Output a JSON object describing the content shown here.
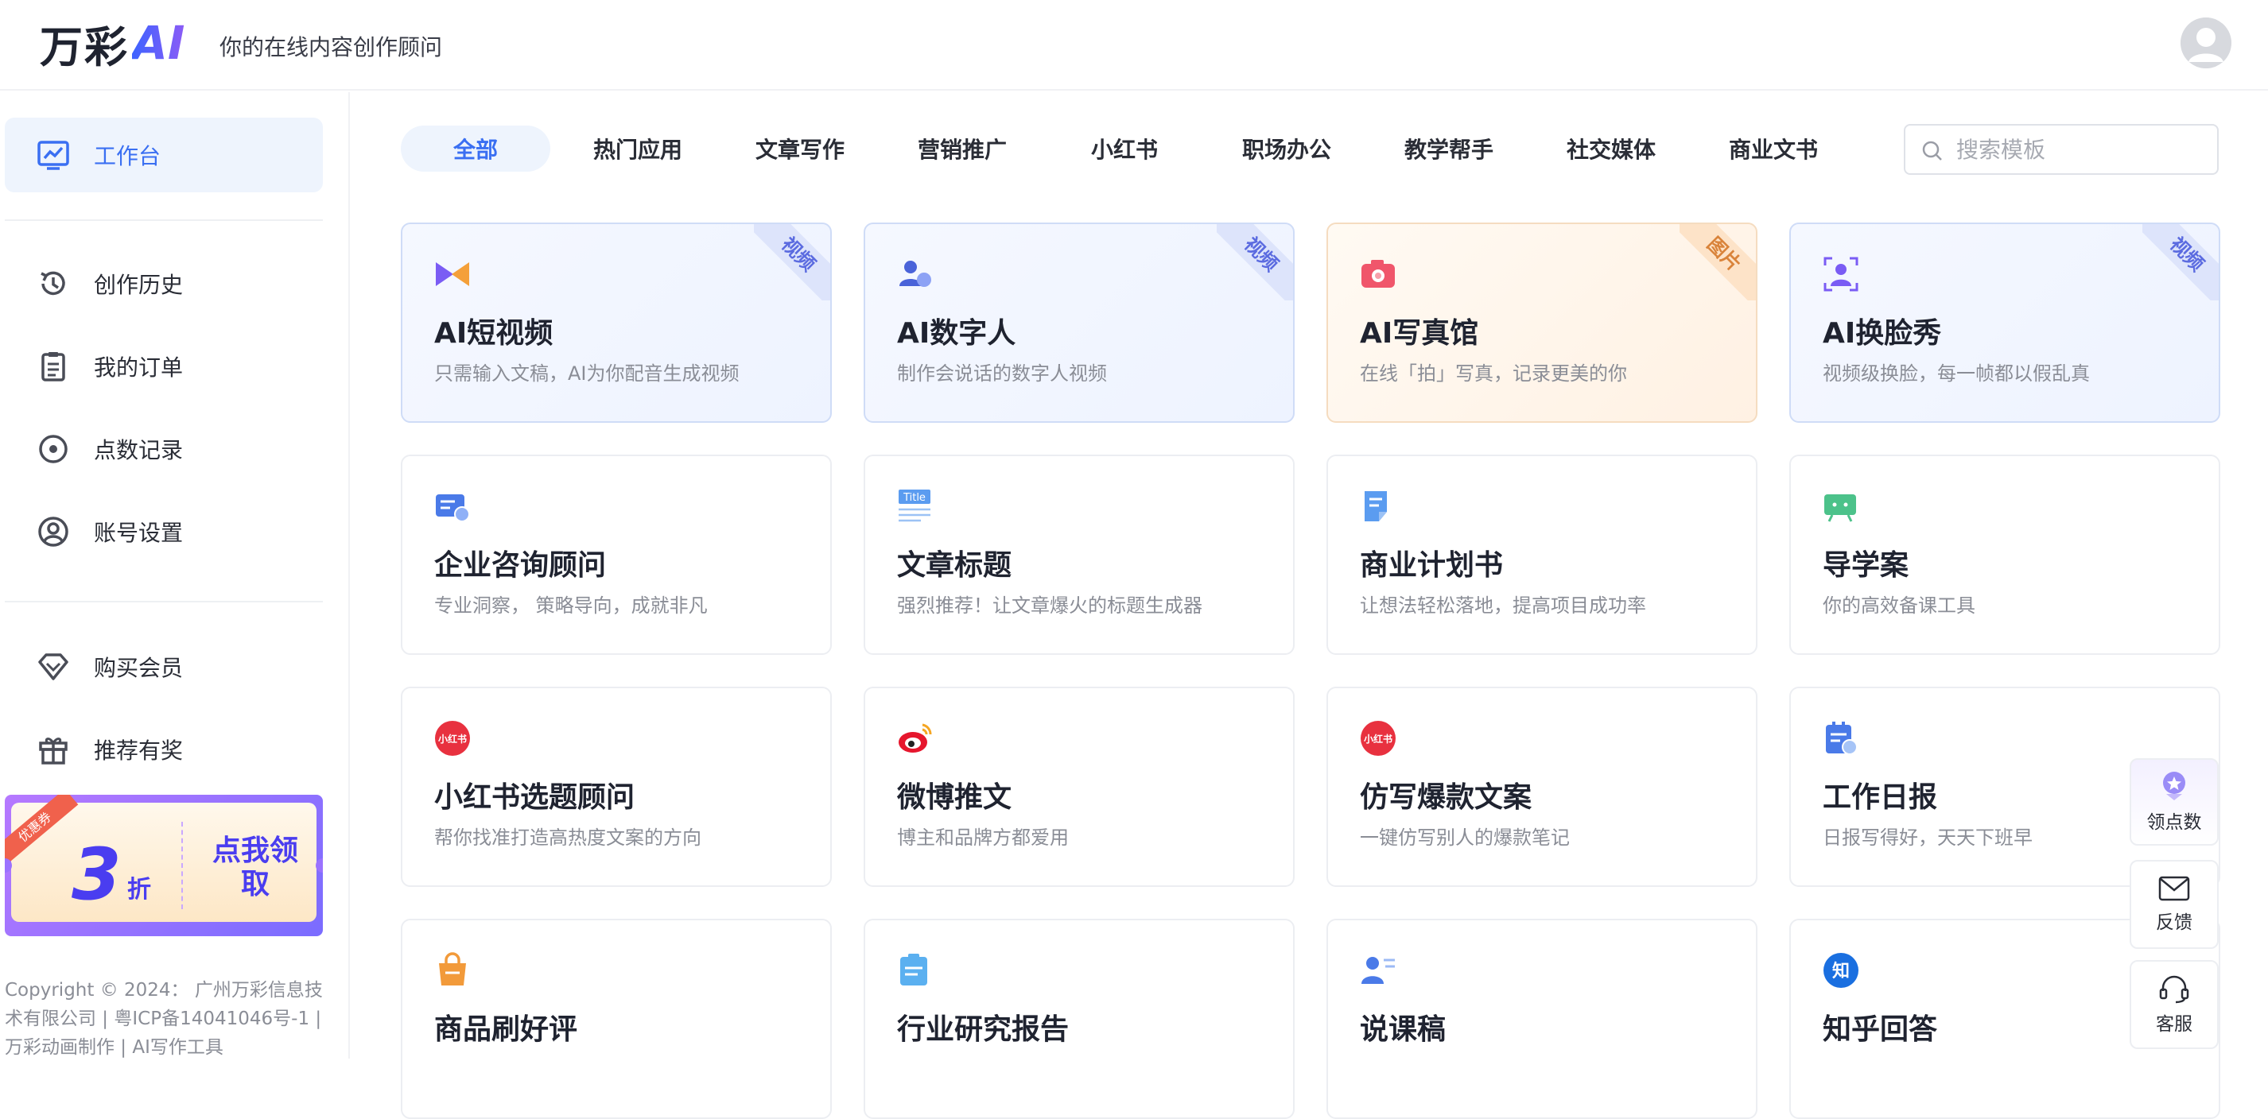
{
  "header": {
    "logo_text": "万彩",
    "logo_ai": "AI",
    "slogan": "你的在线内容创作顾问"
  },
  "sidebar": {
    "items": [
      {
        "label": "工作台",
        "icon": "dashboard-icon"
      },
      {
        "label": "创作历史",
        "icon": "history-icon"
      },
      {
        "label": "我的订单",
        "icon": "order-icon"
      },
      {
        "label": "点数记录",
        "icon": "points-icon"
      },
      {
        "label": "账号设置",
        "icon": "account-icon"
      },
      {
        "label": "购买会员",
        "icon": "diamond-icon"
      },
      {
        "label": "推荐有奖",
        "icon": "gift-icon"
      }
    ],
    "promo": {
      "ribbon": "优惠券",
      "number": "3",
      "unit": "折",
      "cta": "点我领取"
    },
    "copyright": "Copyright © 2024： 广州万彩信息技术有限公司 | 粤ICP备14041046号-1 | 万彩动画制作 | AI写作工具"
  },
  "tabs": [
    "全部",
    "热门应用",
    "文章写作",
    "营销推广",
    "小红书",
    "职场办公",
    "教学帮手",
    "社交媒体",
    "商业文书"
  ],
  "search": {
    "placeholder": "搜索模板"
  },
  "cards": [
    {
      "title": "AI短视频",
      "desc": "只需输入文稿，AI为你配音生成视频",
      "badge": "视频",
      "icon": "video-play-icon"
    },
    {
      "title": "AI数字人",
      "desc": "制作会说话的数字人视频",
      "badge": "视频",
      "icon": "digital-human-icon"
    },
    {
      "title": "AI写真馆",
      "desc": "在线「拍」写真，记录更美的你",
      "badge": "图片",
      "icon": "camera-icon"
    },
    {
      "title": "AI换脸秀",
      "desc": "视频级换脸，每一帧都以假乱真",
      "badge": "视频",
      "icon": "face-swap-icon"
    },
    {
      "title": "企业咨询顾问",
      "desc": "专业洞察， 策略导向，成就非凡",
      "icon": "consult-card-icon"
    },
    {
      "title": "文章标题",
      "desc": "强烈推荐！让文章爆火的标题生成器",
      "icon": "title-icon"
    },
    {
      "title": "商业计划书",
      "desc": "让想法轻松落地，提高项目成功率",
      "icon": "business-plan-icon"
    },
    {
      "title": "导学案",
      "desc": "你的高效备课工具",
      "icon": "lesson-board-icon"
    },
    {
      "title": "小红书选题顾问",
      "desc": "帮你找准打造高热度文案的方向",
      "icon": "xiaohongshu-icon",
      "icon_text": "小红书"
    },
    {
      "title": "微博推文",
      "desc": "博主和品牌方都爱用",
      "icon": "weibo-icon"
    },
    {
      "title": "仿写爆款文案",
      "desc": "一键仿写别人的爆款笔记",
      "icon": "xiaohongshu-icon",
      "icon_text": "小红书"
    },
    {
      "title": "工作日报",
      "desc": "日报写得好，天天下班早",
      "icon": "daily-report-icon"
    },
    {
      "title": "商品刷好评",
      "desc": "",
      "icon": "shopping-bag-icon"
    },
    {
      "title": "行业研究报告",
      "desc": "",
      "icon": "research-report-icon"
    },
    {
      "title": "说课稿",
      "desc": "",
      "icon": "lecture-icon"
    },
    {
      "title": "知乎回答",
      "desc": "",
      "icon": "zhihu-icon",
      "icon_text": "知"
    }
  ],
  "float": [
    {
      "label": "领点数",
      "icon": "coin-reward-icon"
    },
    {
      "label": "反馈",
      "icon": "mail-icon"
    },
    {
      "label": "客服",
      "icon": "headset-icon"
    }
  ],
  "colors": {
    "accent": "#3a6ff2",
    "active_bg": "#eef4fd",
    "promo": "#4a3df0"
  }
}
